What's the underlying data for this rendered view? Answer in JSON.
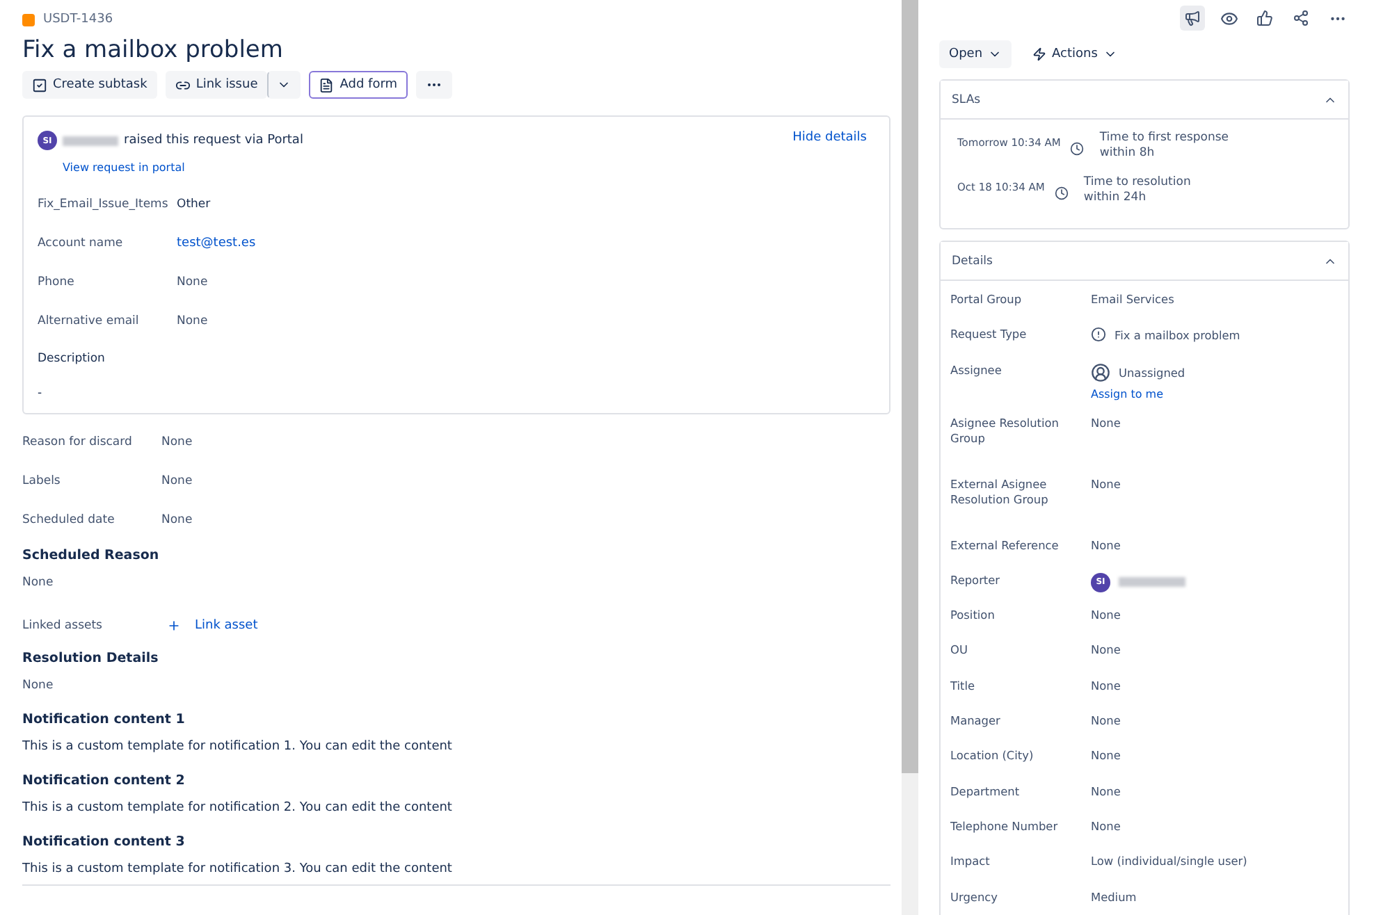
{
  "issue": {
    "key": "USDT-1436",
    "title": "Fix a mailbox problem"
  },
  "toolbar": {
    "buttons": [
      {
        "label": "Create subtask",
        "kind": "subtask",
        "selected": false
      },
      {
        "label": "Link issue",
        "kind": "link",
        "selected": false
      },
      {
        "label": "Add form",
        "kind": "form",
        "selected": true
      }
    ]
  },
  "request": {
    "avatar": "SI",
    "text": "raised this request via",
    "channel": "Portal",
    "view_link": "View request in portal",
    "hide_link": "Hide details",
    "fields": [
      {
        "label": "Fix_Email_Issue_Items",
        "value": "Other",
        "kind": "text"
      },
      {
        "label": "Account name",
        "value": "test@test.es",
        "kind": "link"
      },
      {
        "label": "Phone",
        "value": "None",
        "kind": "empty"
      },
      {
        "label": "Alternative email",
        "value": "None",
        "kind": "empty"
      }
    ],
    "description": {
      "label": "Description",
      "value": "-"
    }
  },
  "fields": [
    {
      "label": "Reason for discard",
      "value": "None"
    },
    {
      "label": "Labels",
      "value": "None"
    },
    {
      "label": "Scheduled date",
      "value": "None"
    }
  ],
  "scheduled_reason": {
    "heading": "Scheduled Reason",
    "value": "None"
  },
  "linked_assets": {
    "label": "Linked assets",
    "action": "Link asset"
  },
  "sections": [
    {
      "heading": "Resolution Details",
      "value": "None",
      "kind": "empty"
    },
    {
      "heading": "Notification content 1",
      "value": "This is a custom template for notification 1. You can edit the content",
      "kind": "text"
    },
    {
      "heading": "Notification content 2",
      "value": "This is a custom template for notification 2. You can edit the content",
      "kind": "text"
    },
    {
      "heading": "Notification content 3",
      "value": "This is a custom template for notification 3. You can edit the content",
      "kind": "text"
    }
  ],
  "status": {
    "label": "Open",
    "actions": "Actions"
  },
  "slas": {
    "title": "SLAs",
    "expanded": true,
    "items": [
      {
        "time": "Tomorrow 10:34 AM",
        "name": "Time to first response",
        "goal": "within 8h"
      },
      {
        "time": "Oct 18 10:34 AM",
        "name": "Time to resolution",
        "goal": "within 24h"
      }
    ]
  },
  "details": {
    "title": "Details",
    "expanded": true,
    "rows": [
      {
        "label": "Portal Group",
        "value": "Email Services",
        "kind": "text"
      },
      {
        "label": "Request Type",
        "value": "Fix a mailbox problem",
        "kind": "request"
      },
      {
        "label": "Assignee",
        "value": "Unassigned",
        "link": "Assign to me",
        "kind": "assignee"
      },
      {
        "label": "Asignee Resolution Group",
        "value": "None",
        "kind": "tall"
      },
      {
        "label": "External Asignee Resolution Group",
        "value": "None",
        "kind": "tall"
      },
      {
        "label": "External Reference",
        "value": "None",
        "kind": "text"
      },
      {
        "label": "Reporter",
        "avatar": "SI",
        "kind": "reporter"
      },
      {
        "label": "Position",
        "value": "None",
        "kind": "text"
      },
      {
        "label": "OU",
        "value": "None",
        "kind": "text"
      },
      {
        "label": "Title",
        "value": "None",
        "kind": "text"
      },
      {
        "label": "Manager",
        "value": "None",
        "kind": "text"
      },
      {
        "label": "Location (City)",
        "value": "None",
        "kind": "text"
      },
      {
        "label": "Department",
        "value": "None",
        "kind": "text"
      },
      {
        "label": "Telephone Number",
        "value": "None",
        "kind": "text"
      },
      {
        "label": "Impact",
        "value": "Low (individual/single user)",
        "kind": "text"
      },
      {
        "label": "Urgency",
        "value": "Medium",
        "kind": "text"
      }
    ]
  }
}
